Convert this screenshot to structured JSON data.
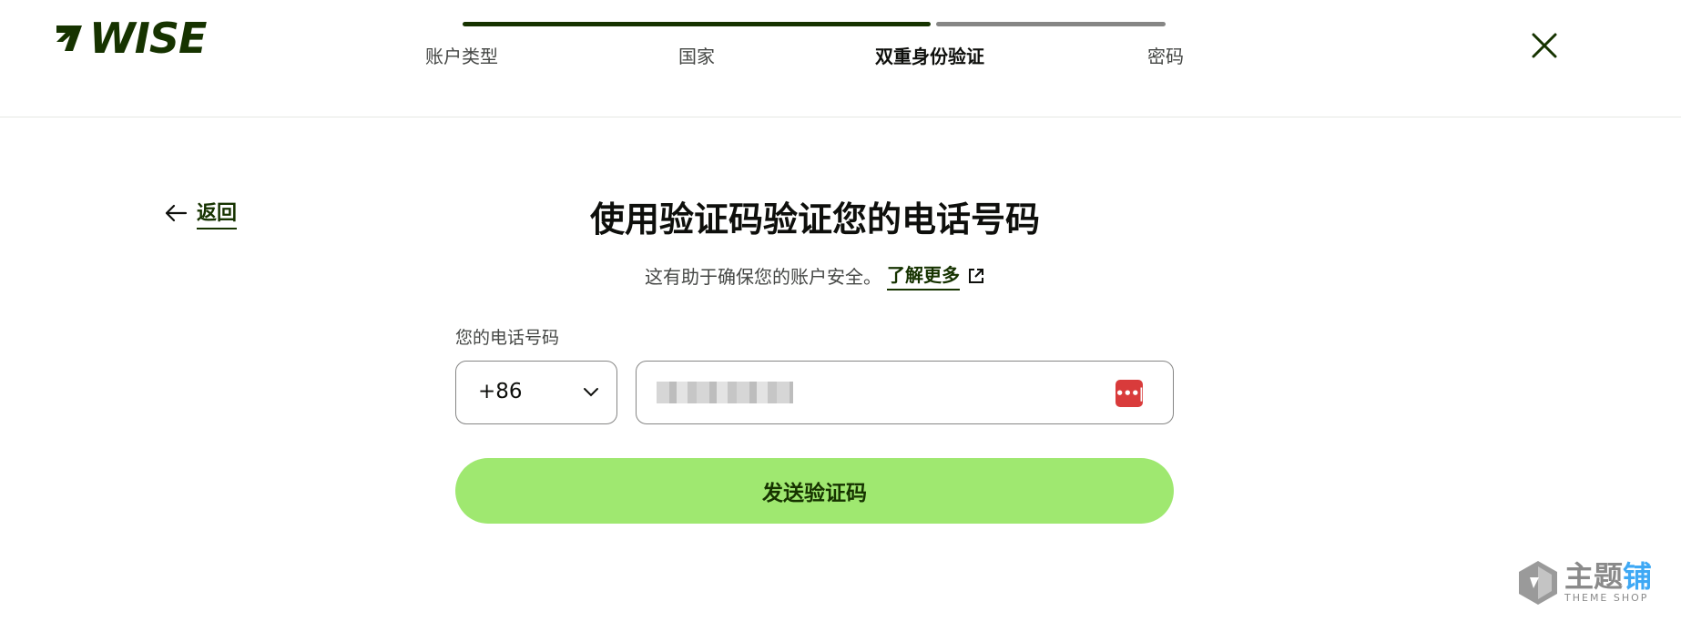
{
  "brand": {
    "name": "WISE",
    "color": "#163300",
    "accent": "#9fe870"
  },
  "progress": {
    "completed_fraction": 0.67
  },
  "steps": [
    {
      "label": "账户类型",
      "active": false
    },
    {
      "label": "国家",
      "active": false
    },
    {
      "label": "双重身份验证",
      "active": true
    },
    {
      "label": "密码",
      "active": false
    }
  ],
  "nav": {
    "back_label": "返回"
  },
  "main": {
    "title": "使用验证码验证您的电话号码",
    "subtitle": "这有助于确保您的账户安全。",
    "learn_more": "了解更多",
    "phone_label": "您的电话号码",
    "country_code": "+86",
    "phone_value": "",
    "send_button": "发送验证码"
  },
  "watermark": {
    "title_gray": "主题",
    "title_blue": "铺",
    "subtitle": "THEME SHOP"
  },
  "icons": [
    "wise-logo-icon",
    "close-icon",
    "arrow-left-icon",
    "external-link-icon",
    "chevron-down-icon",
    "password-manager-icon"
  ]
}
